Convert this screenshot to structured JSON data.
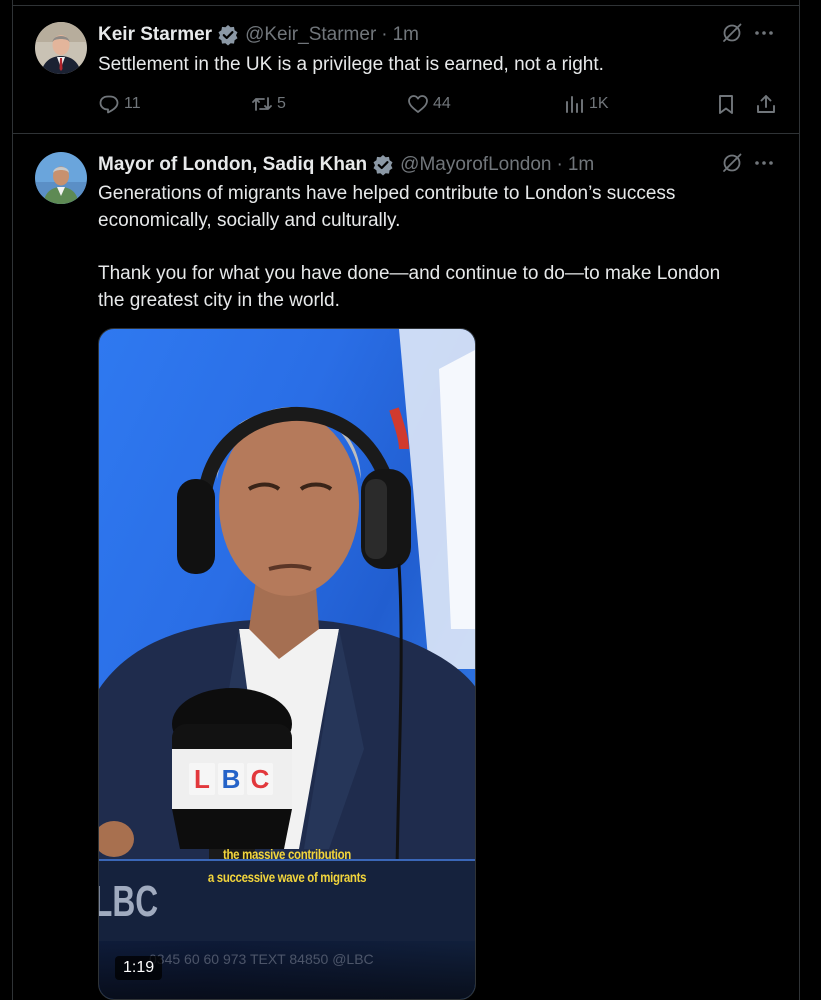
{
  "accent_color": "#1d9bf0",
  "verified_badge_color": "#8b98a5",
  "tweets": [
    {
      "display_name": "Keir Starmer",
      "handle": "@Keir_Starmer",
      "separator": "·",
      "time": "1m",
      "verified_icon": "verified-badge-icon",
      "text": [
        "Settlement in the UK is a privilege that is earned, not a right."
      ],
      "stats": {
        "replies": "11",
        "reposts": "5",
        "likes": "44",
        "views": "1K"
      }
    },
    {
      "display_name": "Mayor of London, Sadiq Khan",
      "handle": "@MayorofLondon",
      "separator": "·",
      "time": "1m",
      "verified_icon": "verified-badge-icon",
      "text": [
        "Generations of migrants have helped contribute to London’s success economically, socially and culturally.",
        "Thank you for what you have done—and continue to do—to make London the greatest city in the world."
      ],
      "video": {
        "duration": "1:19",
        "captions": [
          "the massive contribution",
          "a successive wave of migrants"
        ],
        "mic_logo_letters": [
          "L",
          "B",
          "C"
        ],
        "background_logo": "LBC",
        "ticker": "0345 60 60 973    TEXT 84850    @LBC"
      }
    }
  ]
}
